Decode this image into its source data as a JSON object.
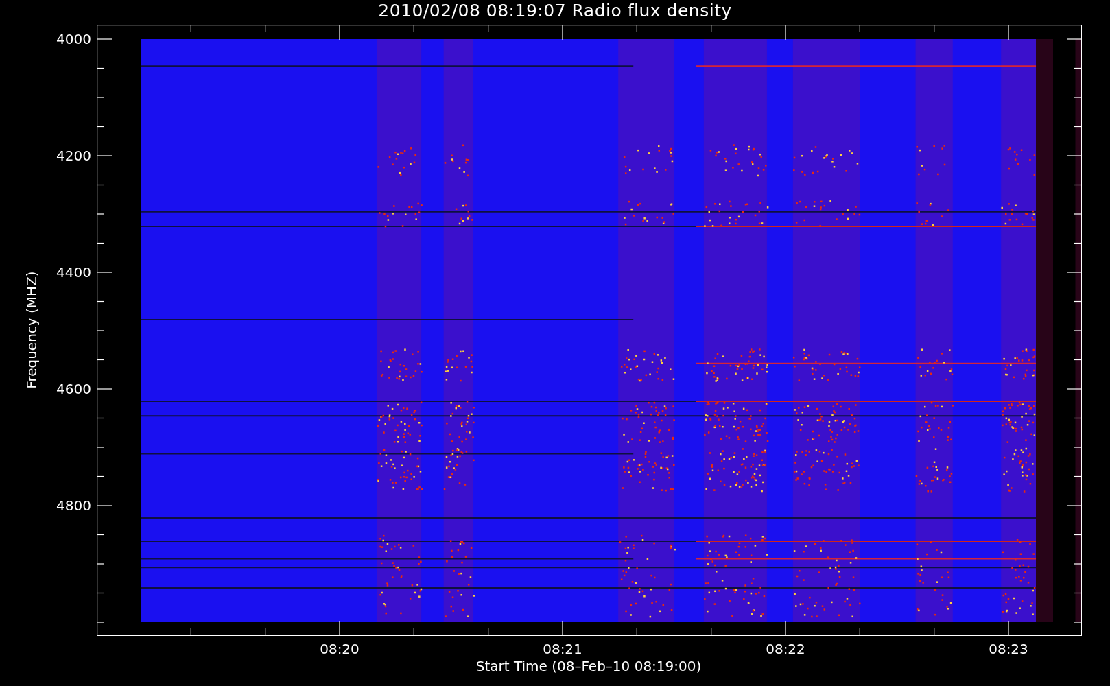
{
  "plot": {
    "title": "2010/02/08 08:19:07 Radio flux density",
    "y_axis": {
      "label": "Frequency (MHZ)",
      "ticks": [
        "4000",
        "4200",
        "4400",
        "4600",
        "4800"
      ]
    },
    "x_axis": {
      "label": "Start Time (08–Feb–10 08:19:00)",
      "ticks": [
        "08:20",
        "08:21",
        "08:22",
        "08:23"
      ]
    }
  }
}
